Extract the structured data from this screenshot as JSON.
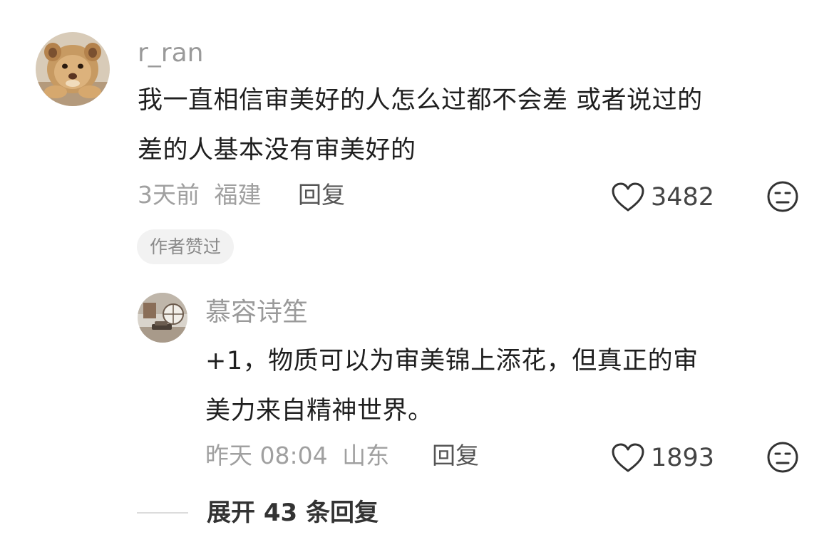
{
  "comment": {
    "username": "r_ran",
    "text_line1": "我一直相信审美好的人怎么过都不会差 或者说过的",
    "text_line2": "差的人基本没有审美好的",
    "time": "3天前",
    "location": "福建",
    "reply_label": "回复",
    "likes": "3482",
    "author_liked_badge": "作者赞过",
    "avatar_icon": "lion-cub-avatar"
  },
  "reply": {
    "username": "慕容诗笙",
    "text_line1": "+1，物质可以为审美锦上添花，但真正的审",
    "text_line2": "美力来自精神世界。",
    "time": "昨天 08:04",
    "location": "山东",
    "reply_label": "回复",
    "likes": "1893",
    "avatar_icon": "living-room-avatar"
  },
  "expand": {
    "label": "展开 43 条回复"
  },
  "icons": {
    "like": "heart-outline-icon",
    "dislike": "unamused-face-icon"
  },
  "colors": {
    "text": "#1f1f1f",
    "meta": "#a0a0a0",
    "badge_bg": "#f2f2f2"
  }
}
